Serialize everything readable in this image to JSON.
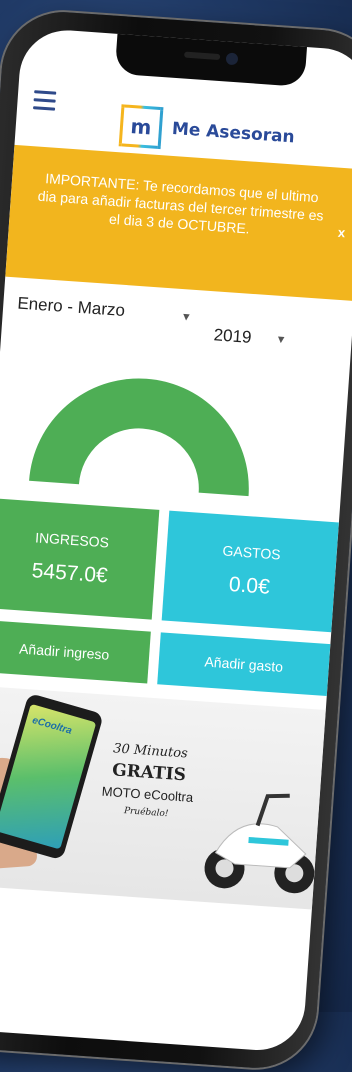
{
  "header": {
    "app_logo_letter": "m",
    "app_name": "Me Asesoran"
  },
  "banner": {
    "text": "IMPORTANTE: Te recordamos que el ultimo dia para añadir facturas del tercer trimestre es el dia 3 de OCTUBRE.",
    "close_label": "x"
  },
  "selectors": {
    "period": "Enero - Marzo",
    "year": "2019"
  },
  "summary": {
    "income_title": "INGRESOS",
    "income_value": "5457.0€",
    "expense_title": "GASTOS",
    "expense_value": "0.0€"
  },
  "actions": {
    "add_income": "Añadir ingreso",
    "add_expense": "Añadir gasto"
  },
  "promo": {
    "phone_brand": "eCooltra",
    "line1": "30 Minutos",
    "line2": "GRATIS",
    "line3": "MOTO eCooltra",
    "line4": "Pruébalo!"
  },
  "colors": {
    "banner": "#f2b51e",
    "income": "#4eae55",
    "expense": "#2ec6da",
    "brand_blue": "#2a4a99"
  },
  "icons": {
    "menu": "hamburger-menu-icon",
    "dropdown": "chevron-down-icon",
    "close": "close-icon"
  }
}
